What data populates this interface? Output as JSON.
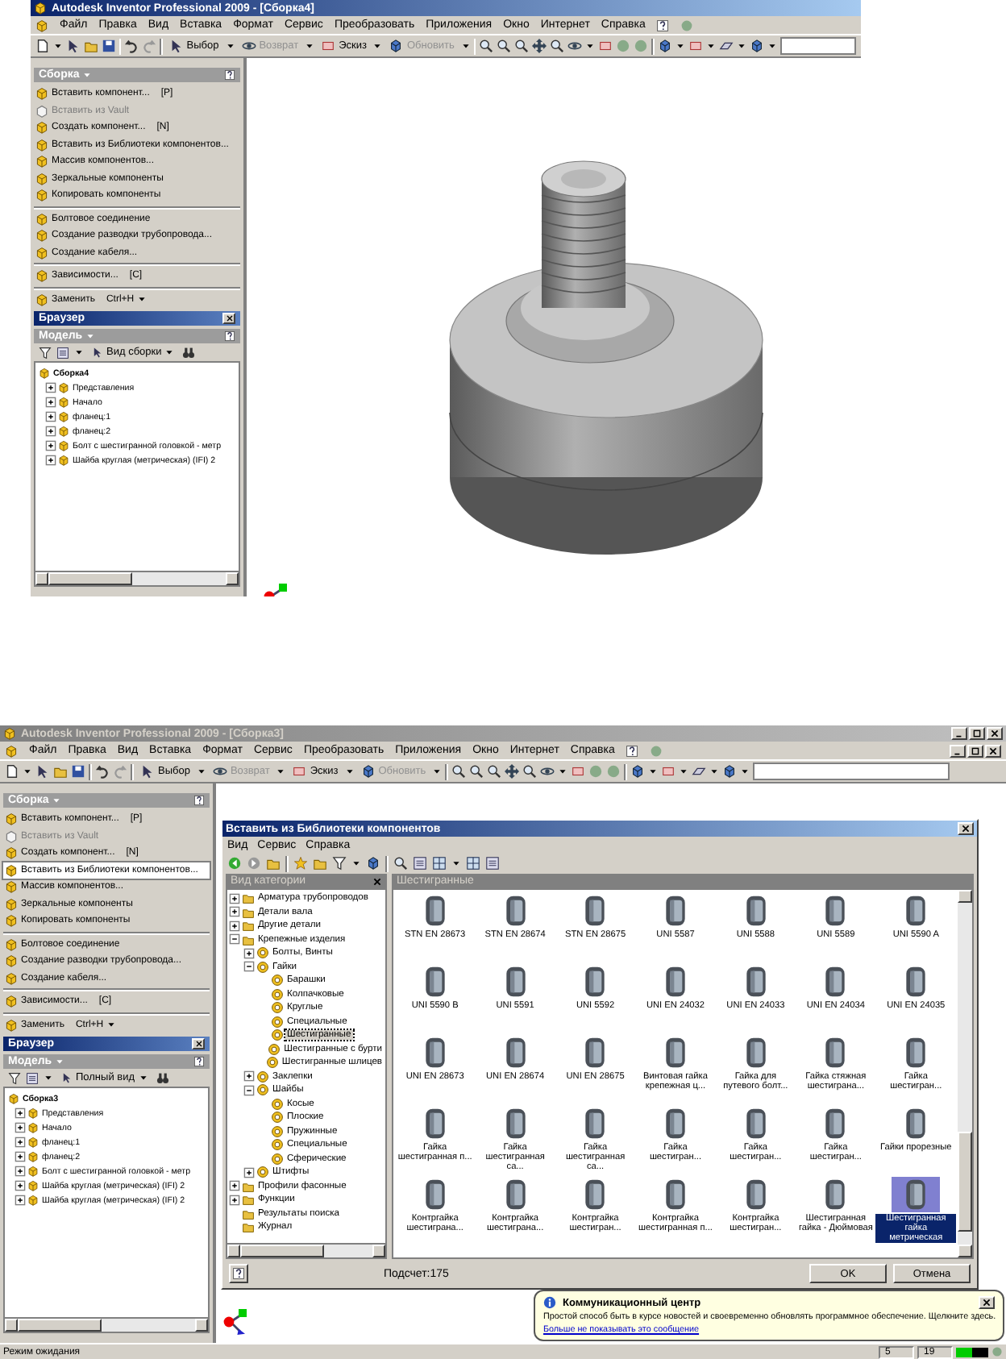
{
  "screenshots": [
    {
      "window": {
        "title": "Autodesk Inventor Professional 2009 - [Сборка4]",
        "active": true,
        "controls": false
      },
      "menu": [
        "Файл",
        "Правка",
        "Вид",
        "Вставка",
        "Формат",
        "Сервис",
        "Преобразовать",
        "Приложения",
        "Окно",
        "Интернет",
        "Справка"
      ],
      "toolbar": [
        {
          "label": "Выбор",
          "disabled": false
        },
        {
          "label": "Возврат",
          "disabled": true
        },
        {
          "label": "Эскиз",
          "disabled": false
        },
        {
          "label": "Обновить",
          "disabled": true
        }
      ],
      "panel": {
        "title": "Сборка",
        "groups": [
          [
            {
              "label": "Вставить компонент...",
              "shortcut": "[P]",
              "kind": "item",
              "disabled": false,
              "selected": false
            },
            {
              "label": "Вставить из Vault",
              "kind": "item",
              "disabled": true,
              "selected": false
            },
            {
              "label": "Создать компонент...",
              "shortcut": "[N]",
              "kind": "item",
              "disabled": false,
              "selected": false
            },
            {
              "label": "Вставить из Библиотеки компонентов...",
              "kind": "item",
              "disabled": false,
              "selected": false
            },
            {
              "label": "Массив компонентов...",
              "kind": "item",
              "disabled": false,
              "selected": false
            },
            {
              "label": "Зеркальные компоненты",
              "kind": "item",
              "disabled": false,
              "selected": false
            },
            {
              "label": "Копировать компоненты",
              "kind": "item",
              "disabled": false,
              "selected": false
            }
          ],
          [
            {
              "label": "Болтовое соединение",
              "kind": "item",
              "disabled": false,
              "selected": false
            },
            {
              "label": "Создание разводки трубопровода...",
              "kind": "item",
              "disabled": false,
              "selected": false
            },
            {
              "label": "Создание кабеля...",
              "kind": "item",
              "disabled": false,
              "selected": false
            }
          ],
          [
            {
              "label": "Зависимости...",
              "shortcut": "[C]",
              "kind": "item",
              "disabled": false,
              "selected": false
            }
          ],
          [
            {
              "label": "Заменить",
              "shortcut": "Ctrl+H",
              "kind": "split",
              "disabled": false,
              "selected": false
            }
          ]
        ]
      },
      "browser": {
        "title": "Браузер",
        "model": "Модель",
        "view_button": "Вид сборки",
        "tree": {
          "label": "Сборка4",
          "children": [
            {
              "label": "Представления",
              "expanded": false
            },
            {
              "label": "Начало",
              "expanded": false
            },
            {
              "label": "фланец:1",
              "expanded": false
            },
            {
              "label": "фланец:2",
              "expanded": false
            },
            {
              "label": "Болт с шестигранной головкой - метр",
              "expanded": false
            },
            {
              "label": "Шайба круглая (метрическая) (IFI) 2",
              "expanded": false
            }
          ]
        }
      },
      "viewport": {
        "kind": "model"
      }
    },
    {
      "window": {
        "title": "Autodesk Inventor Professional 2009 - [Сборка3]",
        "active": false,
        "controls": true
      },
      "menu": [
        "Файл",
        "Правка",
        "Вид",
        "Вставка",
        "Формат",
        "Сервис",
        "Преобразовать",
        "Приложения",
        "Окно",
        "Интернет",
        "Справка"
      ],
      "toolbar": [
        {
          "label": "Выбор",
          "disabled": false
        },
        {
          "label": "Возврат",
          "disabled": true
        },
        {
          "label": "Эскиз",
          "disabled": false
        },
        {
          "label": "Обновить",
          "disabled": true
        }
      ],
      "panel": {
        "title": "Сборка",
        "groups": [
          [
            {
              "label": "Вставить компонент...",
              "shortcut": "[P]",
              "kind": "item",
              "disabled": false,
              "selected": false
            },
            {
              "label": "Вставить из Vault",
              "kind": "item",
              "disabled": true,
              "selected": false
            },
            {
              "label": "Создать компонент...",
              "shortcut": "[N]",
              "kind": "item",
              "disabled": false,
              "selected": false
            },
            {
              "label": "Вставить из Библиотеки компонентов...",
              "kind": "item",
              "disabled": false,
              "selected": true
            },
            {
              "label": "Массив компонентов...",
              "kind": "item",
              "disabled": false,
              "selected": false
            },
            {
              "label": "Зеркальные компоненты",
              "kind": "item",
              "disabled": false,
              "selected": false
            },
            {
              "label": "Копировать компоненты",
              "kind": "item",
              "disabled": false,
              "selected": false
            }
          ],
          [
            {
              "label": "Болтовое соединение",
              "kind": "item",
              "disabled": false,
              "selected": false
            },
            {
              "label": "Создание разводки трубопровода...",
              "kind": "item",
              "disabled": false,
              "selected": false
            },
            {
              "label": "Создание кабеля...",
              "kind": "item",
              "disabled": false,
              "selected": false
            }
          ],
          [
            {
              "label": "Зависимости...",
              "shortcut": "[C]",
              "kind": "item",
              "disabled": false,
              "selected": false
            }
          ],
          [
            {
              "label": "Заменить",
              "shortcut": "Ctrl+H",
              "kind": "split",
              "disabled": false,
              "selected": false
            }
          ]
        ]
      },
      "browser": {
        "title": "Браузер",
        "model": "Модель",
        "view_button": "Полный вид",
        "tree": {
          "label": "Сборка3",
          "children": [
            {
              "label": "Представления",
              "expanded": false
            },
            {
              "label": "Начало",
              "expanded": false
            },
            {
              "label": "фланец:1",
              "expanded": false
            },
            {
              "label": "фланец:2",
              "expanded": false
            },
            {
              "label": "Болт с шестигранной головкой - метр",
              "expanded": false
            },
            {
              "label": "Шайба круглая (метрическая) (IFI) 2",
              "expanded": false
            },
            {
              "label": "Шайба круглая (метрическая) (IFI) 2",
              "expanded": false
            }
          ]
        }
      },
      "viewport": {
        "kind": "empty"
      },
      "dialog": {
        "title": "Вставить из Библиотеки компонентов",
        "menu": [
          "Вид",
          "Сервис",
          "Справка"
        ],
        "tree_title": "Вид категории",
        "list_title": "Шестигранные",
        "tree": [
          {
            "label": "Арматура трубопроводов",
            "expanded": false,
            "selected": false
          },
          {
            "label": "Детали вала",
            "expanded": false,
            "selected": false
          },
          {
            "label": "Другие детали",
            "expanded": false,
            "selected": false
          },
          {
            "label": "Крепежные изделия",
            "expanded": true,
            "selected": false,
            "children": [
              {
                "label": "Болты, Винты",
                "expanded": false,
                "selected": false
              },
              {
                "label": "Гайки",
                "expanded": true,
                "selected": false,
                "children": [
                  {
                    "label": "Барашки",
                    "selected": false
                  },
                  {
                    "label": "Колпачковые",
                    "selected": false
                  },
                  {
                    "label": "Круглые",
                    "selected": false
                  },
                  {
                    "label": "Специальные",
                    "selected": false
                  },
                  {
                    "label": "Шестигранные",
                    "selected": true
                  },
                  {
                    "label": "Шестигранные с бурти",
                    "selected": false
                  },
                  {
                    "label": "Шестигранные шлицев",
                    "selected": false
                  }
                ]
              },
              {
                "label": "Заклепки",
                "expanded": false,
                "selected": false
              },
              {
                "label": "Шайбы",
                "expanded": true,
                "selected": false,
                "children": [
                  {
                    "label": "Косые",
                    "selected": false
                  },
                  {
                    "label": "Плоские",
                    "selected": false
                  },
                  {
                    "label": "Пружинные",
                    "selected": false
                  },
                  {
                    "label": "Специальные",
                    "selected": false
                  },
                  {
                    "label": "Сферические",
                    "selected": false
                  }
                ]
              },
              {
                "label": "Штифты",
                "expanded": false,
                "selected": false
              }
            ]
          },
          {
            "label": "Профили фасонные",
            "expanded": false,
            "selected": false
          },
          {
            "label": "Функции",
            "expanded": false,
            "selected": false
          },
          {
            "label": "Результаты поиска",
            "selected": false
          },
          {
            "label": "Журнал",
            "selected": false
          }
        ],
        "items": [
          {
            "label": "STN EN 28673",
            "selected": false
          },
          {
            "label": "STN EN 28674",
            "selected": false
          },
          {
            "label": "STN EN 28675",
            "selected": false
          },
          {
            "label": "UNI 5587",
            "selected": false
          },
          {
            "label": "UNI 5588",
            "selected": false
          },
          {
            "label": "UNI 5589",
            "selected": false
          },
          {
            "label": "UNI 5590 A",
            "selected": false
          },
          {
            "label": "UNI 5590 B",
            "selected": false
          },
          {
            "label": "UNI 5591",
            "selected": false
          },
          {
            "label": "UNI 5592",
            "selected": false
          },
          {
            "label": "UNI EN 24032",
            "selected": false
          },
          {
            "label": "UNI EN 24033",
            "selected": false
          },
          {
            "label": "UNI EN 24034",
            "selected": false
          },
          {
            "label": "UNI EN 24035",
            "selected": false
          },
          {
            "label": "UNI EN 28673",
            "selected": false
          },
          {
            "label": "UNI EN 28674",
            "selected": false
          },
          {
            "label": "UNI EN 28675",
            "selected": false
          },
          {
            "label": "Винтовая гайка крепежная ц...",
            "selected": false
          },
          {
            "label": "Гайка для путевого болт...",
            "selected": false
          },
          {
            "label": "Гайка стяжная шестиграна...",
            "selected": false
          },
          {
            "label": "Гайка шестигран...",
            "selected": false
          },
          {
            "label": "Гайка шестигранная п...",
            "selected": false
          },
          {
            "label": "Гайка шестигранная са...",
            "selected": false
          },
          {
            "label": "Гайка шестигранная са...",
            "selected": false
          },
          {
            "label": "Гайка шестигран...",
            "selected": false
          },
          {
            "label": "Гайка шестигран...",
            "selected": false
          },
          {
            "label": "Гайка шестигран...",
            "selected": false
          },
          {
            "label": "Гайки прорезные",
            "selected": false
          },
          {
            "label": "Контргайка шестиграна...",
            "selected": false
          },
          {
            "label": "Контргайка шестиграна...",
            "selected": false
          },
          {
            "label": "Контргайка шестигран...",
            "selected": false
          },
          {
            "label": "Контргайка шестигранная п...",
            "selected": false
          },
          {
            "label": "Контргайка шестигран...",
            "selected": false
          },
          {
            "label": "Шестигранная гайка - Дюймовая",
            "selected": false
          },
          {
            "label": "Шестигранная гайка метрическая",
            "selected": true
          }
        ],
        "count": "Подсчет:175",
        "buttons": [
          "OK",
          "Отмена"
        ]
      },
      "notification": {
        "title": "Коммуникационный центр",
        "text": "Простой способ быть в курсе новостей и своевременно обновлять программное обеспечение. Щелкните здесь.",
        "link": "Больше не показывать это сообщение"
      },
      "status_bar": {
        "text": "Режим ожидания",
        "cells": [
          "5",
          "19"
        ]
      }
    }
  ]
}
